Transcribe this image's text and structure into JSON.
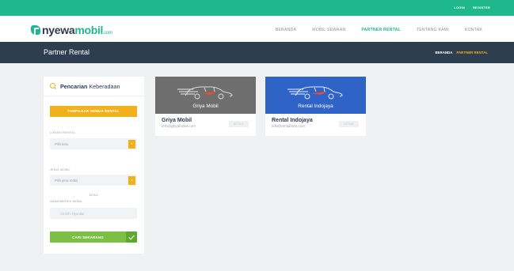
{
  "topbar": {
    "login": "LOGIN",
    "register": "REGISTER"
  },
  "brand": {
    "part1": "nyewa",
    "part2": "mobil",
    "suffix": ".com"
  },
  "nav": {
    "items": [
      {
        "label": "BERANDA"
      },
      {
        "label": "MOBIL SEWAAN"
      },
      {
        "label": "PARTNER RENTAL",
        "active": true
      },
      {
        "label": "TENTANG KAMI"
      },
      {
        "label": "KONTAK"
      }
    ]
  },
  "page": {
    "title": "Partner Rental",
    "breadcrumb": {
      "home": "BERANDA",
      "current": "PARTNER RENTAL"
    }
  },
  "sidebar": {
    "heading_strong": "Pencarian",
    "heading_light": "Keberadaan",
    "show_all_button": "TAMPILKAN SEMUA RENTAL",
    "location_label": "LOKASI RENTAL",
    "location_placeholder": "Pilih kota",
    "car_type_label": "JENIS MOBIL",
    "car_type_placeholder": "Pilih jenis mobil",
    "or_text": "ATAU",
    "car_name_label": "NAMA/MEREK MOBIL",
    "car_name_placeholder": "contoh: Hyundai",
    "search_button": "CARI SEKARANG"
  },
  "partners": [
    {
      "banner_label": "Griya Mobil",
      "name": "Griya Mobil",
      "email": "info@griyamobil.com",
      "detail": "DETAIL",
      "color": "#6e6e6e"
    },
    {
      "banner_label": "Rental Indojaya",
      "name": "Rental Indojaya",
      "email": "info@rentalindo.com",
      "detail": "DETAIL",
      "color": "#2f63c5"
    }
  ],
  "colors": {
    "green": "#1fb88e",
    "navy": "#2c3e50",
    "yellow": "#f0b11a",
    "lime": "#7cc043"
  },
  "icons": {
    "search": "search-icon",
    "dropdown": "caret-icon",
    "confirm": "check-icon",
    "car": "car-icon"
  }
}
